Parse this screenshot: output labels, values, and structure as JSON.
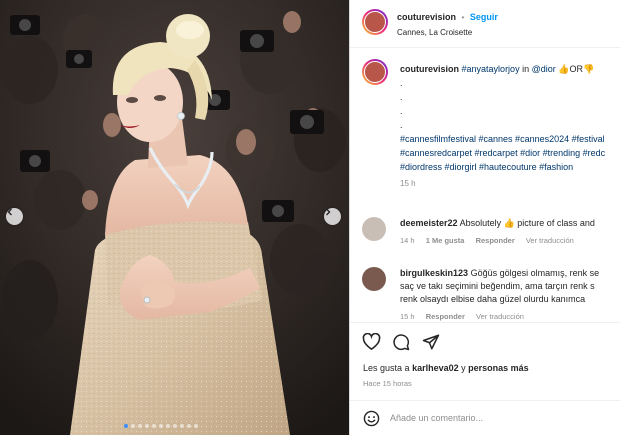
{
  "header": {
    "username": "couturevision",
    "separator": "•",
    "follow_label": "Seguir",
    "location": "Cannes, La Croisette"
  },
  "caption": {
    "username": "couturevision",
    "mention_1": "#anyataylorjoy",
    "word_in": "in",
    "mention_2": "@dior",
    "emoji_text": "👍OR👎",
    "dots": [
      ".",
      ".",
      ".",
      "."
    ],
    "hashtags_line_1": "#cannesfilmfestival #cannes #cannes2024 #festival",
    "hashtags_line_2": "#cannesredcarpet #redcarpet #dior #trending #redc",
    "hashtags_line_3": "#diordress #diorgirl #hautecouture #fashion",
    "time": "15 h"
  },
  "comments": [
    {
      "username": "deemeister22",
      "text": "Absolutely 👍 picture of class and",
      "time": "14 h",
      "likes": "1 Me gusta",
      "reply": "Responder",
      "view_translation": "Ver traducción"
    },
    {
      "username": "birgulkeskin123",
      "text_line_1": "Göğüs gölgesi olmamış, renk se",
      "text_line_2": "saç ve takı seçimini beğendim, ama tarçın renk s",
      "text_line_3": "renk olsaydı elbise daha güzel olurdu kanımca",
      "time": "15 h",
      "reply": "Responder",
      "view_translation": "Ver traducción"
    }
  ],
  "likes": {
    "prefix": "Les gusta a",
    "user": "karlheva02",
    "middle": "y",
    "others": "personas más"
  },
  "posted_ago": "Hace 15 horas",
  "add_comment": {
    "placeholder": "Añade un comentario..."
  },
  "carousel": {
    "slide_count": 11,
    "active_index": 0
  },
  "icons": {
    "prev": "chevron-left-icon",
    "next": "chevron-right-icon",
    "like": "heart-icon",
    "comment": "comment-icon",
    "share": "paper-plane-icon",
    "emoji": "smiley-icon"
  },
  "colors": {
    "accent": "#0095f6",
    "hashtag": "#00376b",
    "muted": "#8e8e8e"
  }
}
